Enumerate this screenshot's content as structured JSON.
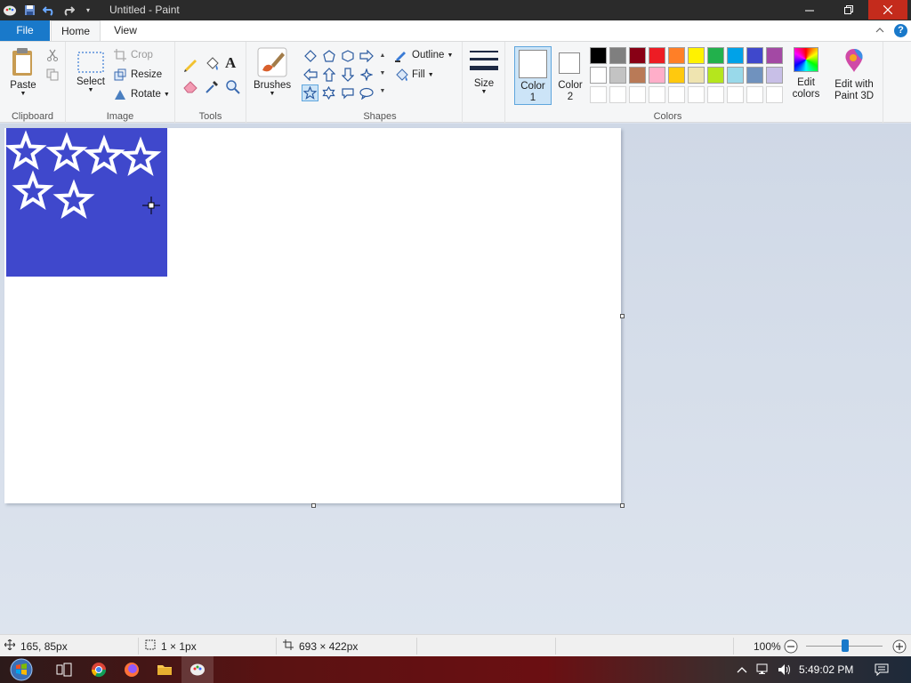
{
  "window": {
    "title": "Untitled - Paint"
  },
  "tabs": [
    {
      "label": "File"
    },
    {
      "label": "Home"
    },
    {
      "label": "View"
    }
  ],
  "ribbon": {
    "clipboard": {
      "paste_label": "Paste",
      "group_label": "Clipboard"
    },
    "image": {
      "select_label": "Select",
      "crop_label": "Crop",
      "resize_label": "Resize",
      "rotate_label": "Rotate",
      "group_label": "Image"
    },
    "tools": {
      "group_label": "Tools"
    },
    "brushes": {
      "label": "Brushes"
    },
    "shapes": {
      "outline_label": "Outline",
      "fill_label": "Fill",
      "group_label": "Shapes",
      "selected_shape": "five-point-star"
    },
    "size": {
      "label": "Size"
    },
    "colors": {
      "color1_label_line1": "Color",
      "color1_label_line2": "1",
      "color2_label_line1": "Color",
      "color2_label_line2": "2",
      "color1_value": "#ffffff",
      "color2_value": "#ffffff",
      "edit_colors_line1": "Edit",
      "edit_colors_line2": "colors",
      "paint3d_line1": "Edit with",
      "paint3d_line2": "Paint 3D",
      "group_label": "Colors",
      "palette_row1": [
        "#000000",
        "#7f7f7f",
        "#880015",
        "#ed1c24",
        "#ff7f27",
        "#fff200",
        "#22b14c",
        "#00a2e8",
        "#3f48cc",
        "#a349a4"
      ],
      "palette_row2": [
        "#ffffff",
        "#c3c3c3",
        "#b97a57",
        "#ffaec9",
        "#ffc90e",
        "#efe4b0",
        "#b5e61d",
        "#99d9ea",
        "#7092be",
        "#c8bfe7"
      ]
    }
  },
  "canvas": {
    "fill_color": "#3f48cc",
    "stars_color": "#ffffff"
  },
  "status": {
    "cursor_pos": "165, 85px",
    "selection_size": "1 × 1px",
    "image_size": "693 × 422px",
    "zoom": "100%"
  },
  "taskbar": {
    "time": "5:49:02 PM"
  }
}
